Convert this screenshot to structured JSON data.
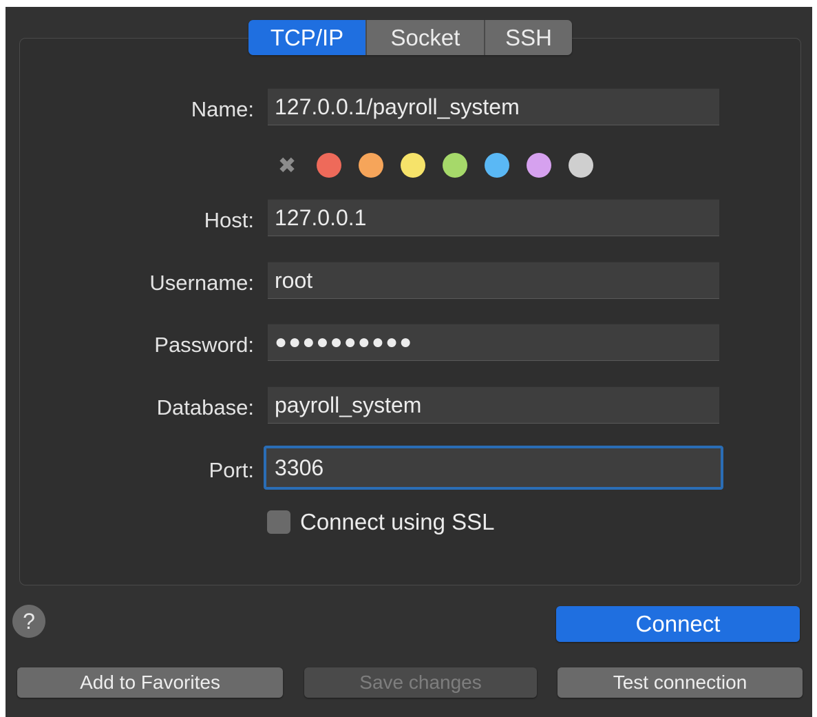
{
  "tabs": [
    {
      "label": "TCP/IP",
      "active": true
    },
    {
      "label": "Socket",
      "active": false
    },
    {
      "label": "SSH",
      "active": false
    }
  ],
  "form": {
    "name_label": "Name:",
    "name_value": "127.0.0.1/payroll_system",
    "host_label": "Host:",
    "host_value": "127.0.0.1",
    "username_label": "Username:",
    "username_value": "root",
    "password_label": "Password:",
    "password_value": "●●●●●●●●●●",
    "database_label": "Database:",
    "database_value": "payroll_system",
    "port_label": "Port:",
    "port_value": "3306",
    "ssl_label": "Connect using SSL",
    "ssl_checked": false
  },
  "color_tags": {
    "clear_icon": "x-icon",
    "colors": [
      "#ee6a5a",
      "#f6a55a",
      "#f6e36a",
      "#a6d96a",
      "#5ab8f5",
      "#d6a1ef",
      "#cfcfcf"
    ]
  },
  "buttons": {
    "help_label": "?",
    "connect_label": "Connect",
    "add_favorites_label": "Add to Favorites",
    "save_changes_label": "Save changes",
    "test_connection_label": "Test connection"
  },
  "theme": {
    "accent": "#1f6fe0",
    "background": "#323232"
  }
}
